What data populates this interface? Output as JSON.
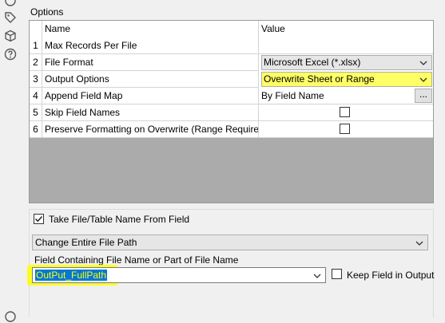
{
  "sidebar": {
    "icons": [
      "partial-top-icon",
      "tag-icon",
      "box-icon",
      "help-icon",
      "partial-bottom-icon"
    ]
  },
  "options": {
    "title": "Options",
    "headers": {
      "name": "Name",
      "value": "Value"
    },
    "rows": [
      {
        "num": "1",
        "name": "Max Records Per File",
        "value": ""
      },
      {
        "num": "2",
        "name": "File Format",
        "value": "Microsoft Excel (*.xlsx)"
      },
      {
        "num": "3",
        "name": "Output Options",
        "value": "Overwrite Sheet or Range"
      },
      {
        "num": "4",
        "name": "Append Field Map",
        "value": "By Field Name",
        "button": "..."
      },
      {
        "num": "5",
        "name": "Skip Field Names",
        "value": ""
      },
      {
        "num": "6",
        "name": "Preserve Formatting on Overwrite (Range Required)",
        "value": ""
      }
    ]
  },
  "take_name": {
    "label": "Take File/Table Name From Field",
    "checked": true,
    "mode": "Change Entire File Path",
    "field_label": "Field Containing File Name or Part of File Name",
    "field_value": "OutPut_FullPath",
    "keep_label": "Keep Field in Output",
    "keep_checked": false
  },
  "colors": {
    "highlight": "#ffff66",
    "selection": "#0078d7"
  }
}
